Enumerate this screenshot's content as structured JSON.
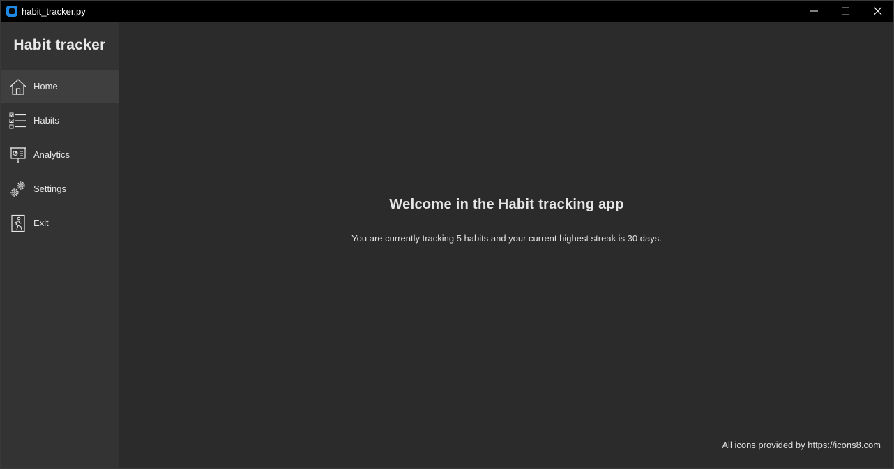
{
  "window": {
    "title": "habit_tracker.py",
    "controls": {
      "minimize": "minimize-icon",
      "maximize": "maximize-icon",
      "close": "close-icon"
    }
  },
  "sidebar": {
    "title": "Habit tracker",
    "items": [
      {
        "label": "Home",
        "icon": "home-icon",
        "active": true
      },
      {
        "label": "Habits",
        "icon": "checklist-icon",
        "active": false
      },
      {
        "label": "Analytics",
        "icon": "presentation-chart-icon",
        "active": false
      },
      {
        "label": "Settings",
        "icon": "gears-icon",
        "active": false
      },
      {
        "label": "Exit",
        "icon": "exit-door-icon",
        "active": false
      }
    ]
  },
  "main": {
    "heading": "Welcome in the Habit tracking app",
    "summary": "You are currently tracking 5 habits and your current highest streak is 30 days.",
    "credits": "All icons provided by https://icons8.com"
  },
  "colors": {
    "titlebar": "#000000",
    "sidebar": "#333333",
    "sidebar_active": "#3f3f3f",
    "main": "#2b2b2b",
    "text": "#e6e6e6",
    "app_icon": "#1e88e5"
  }
}
